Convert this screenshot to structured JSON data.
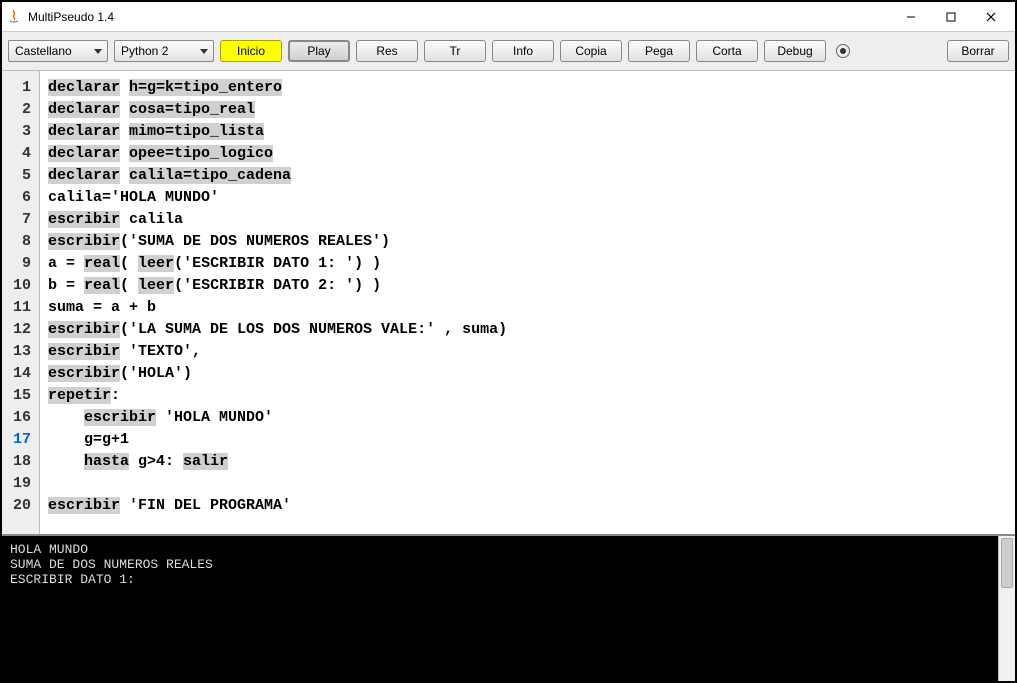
{
  "window": {
    "title": "MultiPseudo 1.4"
  },
  "toolbar": {
    "lang_dropdown": "Castellano",
    "python_dropdown": "Python 2",
    "inicio": "Inicio",
    "play": "Play",
    "res": "Res",
    "tr": "Tr",
    "info": "Info",
    "copia": "Copia",
    "pega": "Pega",
    "corta": "Corta",
    "debug": "Debug",
    "borrar": "Borrar"
  },
  "code": {
    "lines": [
      {
        "n": "1",
        "segs": [
          {
            "t": "declarar",
            "h": 1
          },
          {
            "t": " "
          },
          {
            "t": "h=g=k=tipo_entero",
            "h": 1
          }
        ]
      },
      {
        "n": "2",
        "segs": [
          {
            "t": "declarar",
            "h": 1
          },
          {
            "t": " "
          },
          {
            "t": "cosa=tipo_real",
            "h": 1
          }
        ]
      },
      {
        "n": "3",
        "segs": [
          {
            "t": "declarar",
            "h": 1
          },
          {
            "t": " "
          },
          {
            "t": "mimo=tipo_lista",
            "h": 1
          }
        ]
      },
      {
        "n": "4",
        "segs": [
          {
            "t": "declarar",
            "h": 1
          },
          {
            "t": " "
          },
          {
            "t": "opee=tipo_logico",
            "h": 1
          }
        ]
      },
      {
        "n": "5",
        "segs": [
          {
            "t": "declarar",
            "h": 1
          },
          {
            "t": " "
          },
          {
            "t": "calila=tipo_cadena",
            "h": 1
          }
        ]
      },
      {
        "n": "6",
        "segs": [
          {
            "t": "calila='HOLA MUNDO'"
          }
        ]
      },
      {
        "n": "7",
        "segs": [
          {
            "t": "escribir",
            "h": 1
          },
          {
            "t": " calila"
          }
        ]
      },
      {
        "n": "8",
        "segs": [
          {
            "t": "escribir",
            "h": 1
          },
          {
            "t": "('SUMA DE DOS NUMEROS REALES')"
          }
        ]
      },
      {
        "n": "9",
        "segs": [
          {
            "t": "a = "
          },
          {
            "t": "real",
            "h": 1
          },
          {
            "t": "( "
          },
          {
            "t": "leer",
            "h": 1
          },
          {
            "t": "('ESCRIBIR DATO 1: ') )"
          }
        ]
      },
      {
        "n": "10",
        "segs": [
          {
            "t": "b = "
          },
          {
            "t": "real",
            "h": 1
          },
          {
            "t": "( "
          },
          {
            "t": "leer",
            "h": 1
          },
          {
            "t": "('ESCRIBIR DATO 2: ') )"
          }
        ]
      },
      {
        "n": "11",
        "segs": [
          {
            "t": "suma = a + b"
          }
        ]
      },
      {
        "n": "12",
        "segs": [
          {
            "t": "escribir",
            "h": 1
          },
          {
            "t": "('LA SUMA DE LOS DOS NUMEROS VALE:' , suma)"
          }
        ]
      },
      {
        "n": "13",
        "segs": [
          {
            "t": "escribir",
            "h": 1
          },
          {
            "t": " 'TEXTO',"
          }
        ]
      },
      {
        "n": "14",
        "segs": [
          {
            "t": "escribir",
            "h": 1
          },
          {
            "t": "('HOLA')"
          }
        ]
      },
      {
        "n": "15",
        "segs": [
          {
            "t": "repetir",
            "h": 1
          },
          {
            "t": ":"
          }
        ]
      },
      {
        "n": "16",
        "segs": [
          {
            "t": "    "
          },
          {
            "t": "escribir",
            "h": 1
          },
          {
            "t": " 'HOLA MUNDO'"
          }
        ]
      },
      {
        "n": "17",
        "blue": 1,
        "segs": [
          {
            "t": "    g=g+1"
          }
        ]
      },
      {
        "n": "18",
        "segs": [
          {
            "t": "    "
          },
          {
            "t": "hasta",
            "h": 1
          },
          {
            "t": " g>4: "
          },
          {
            "t": "salir",
            "h": 1
          }
        ]
      },
      {
        "n": "19",
        "segs": [
          {
            "t": ""
          }
        ]
      },
      {
        "n": "20",
        "segs": [
          {
            "t": "escribir",
            "h": 1
          },
          {
            "t": " 'FIN DEL PROGRAMA'"
          }
        ]
      }
    ]
  },
  "console": "HOLA MUNDO\nSUMA DE DOS NUMEROS REALES\nESCRIBIR DATO 1: "
}
